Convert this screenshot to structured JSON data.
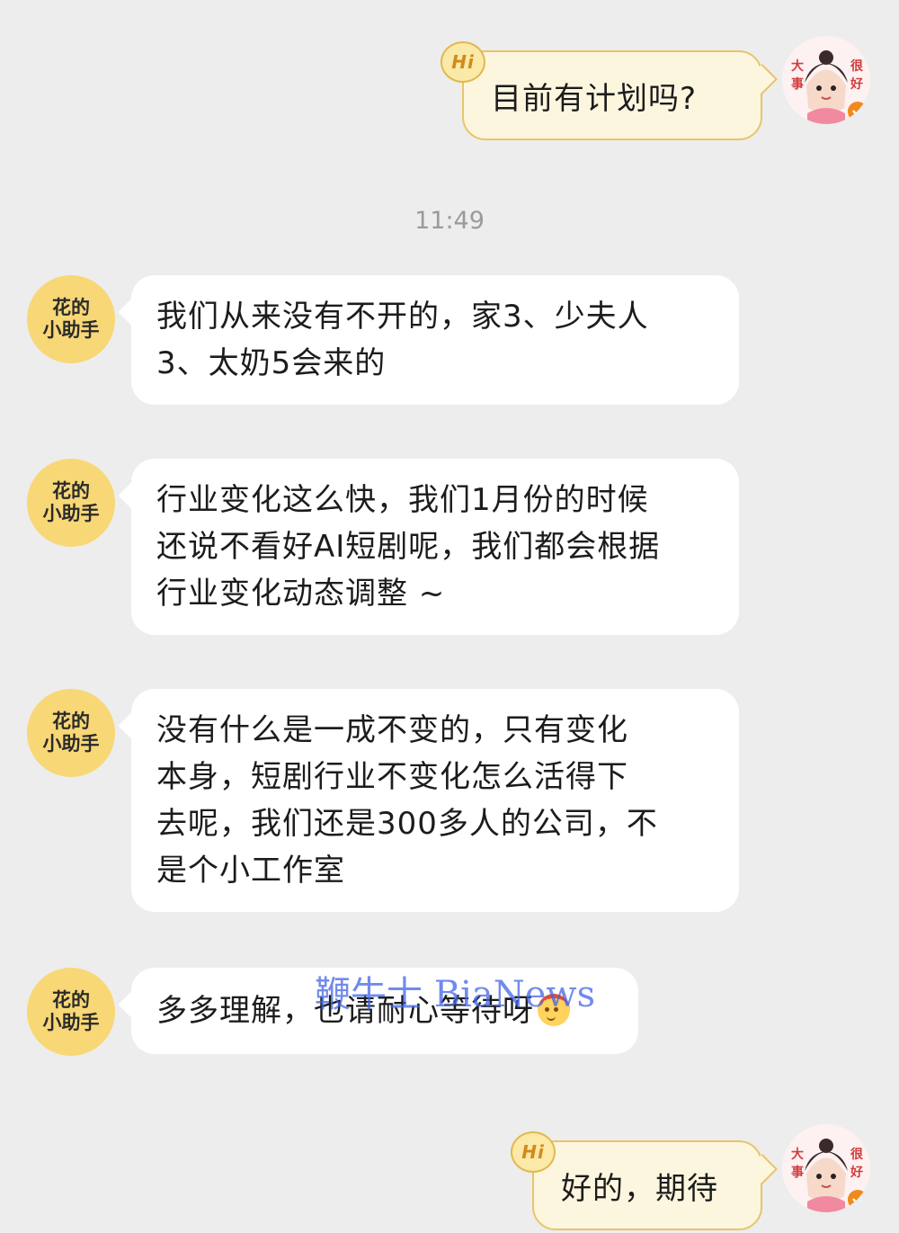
{
  "messages": {
    "m1_text": "目前有计划吗?",
    "timestamp": "11:49",
    "m2_lines": [
      "我们从来没有不开的，家3、少夫人",
      "3、太奶5会来的"
    ],
    "m3_lines": [
      "行业变化这么快，我们1月份的时候",
      "还说不看好AI短剧呢，我们都会根据",
      "行业变化动态调整 ~"
    ],
    "m4_lines": [
      "没有什么是一成不变的，只有变化",
      "本身，短剧行业不变化怎么活得下",
      "去呢，我们还是300多人的公司，不",
      "是个小工作室"
    ],
    "m5_text": "多多理解，也请耐心等待呀",
    "m6_text": "好的，期待"
  },
  "assistant_avatar": {
    "line1": "花的",
    "line2": "小助手",
    "color": "#f8d776"
  },
  "hi_badge": "Hi",
  "emoji_icon": "smiling-face-with-headband-emoji",
  "watermark": "鞭牛士 BiaNews",
  "colors": {
    "background": "#ededed",
    "user_bubble": "#fdf6df",
    "user_bubble_border": "#e8c46a",
    "assistant_bubble": "#ffffff",
    "watermark": "#4264e6"
  }
}
